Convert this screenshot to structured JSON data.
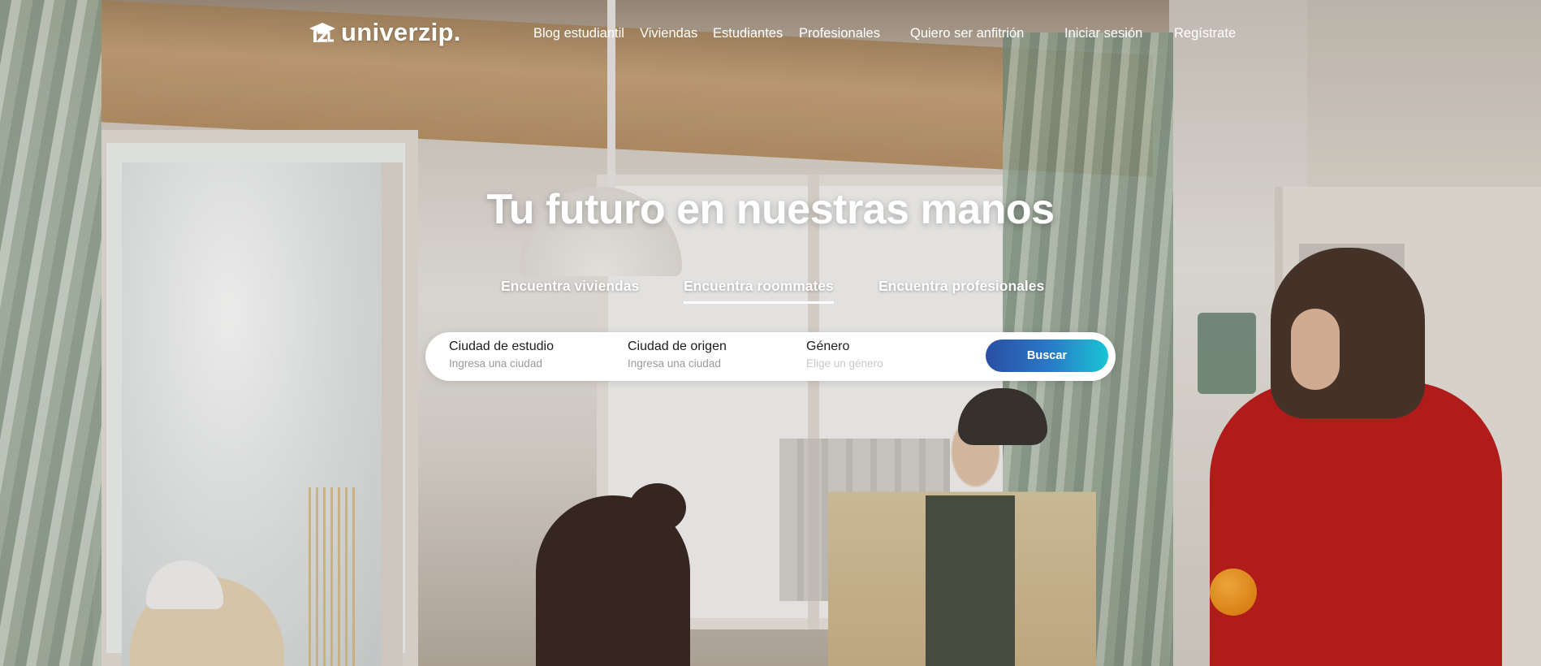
{
  "brand": {
    "name": "univerzip."
  },
  "nav": {
    "blog": "Blog estudiantil",
    "viviendas": "Viviendas",
    "estudiantes": "Estudiantes",
    "profesionales": "Profesionales",
    "anfitrion": "Quiero ser anfitrión",
    "login": "Iniciar sesión",
    "register": "Regístrate"
  },
  "hero": {
    "title": "Tu futuro en nuestras manos",
    "tabs": [
      {
        "label": "Encuentra viviendas",
        "active": false
      },
      {
        "label": "Encuentra roommates",
        "active": true
      },
      {
        "label": "Encuentra profesionales",
        "active": false
      }
    ]
  },
  "search": {
    "fields": [
      {
        "label": "Ciudad de estudio",
        "placeholder": "Ingresa una ciudad"
      },
      {
        "label": "Ciudad de origen",
        "placeholder": "Ingresa una ciudad"
      },
      {
        "label": "Género",
        "placeholder": "Elige un género"
      }
    ],
    "button": "Buscar"
  },
  "colors": {
    "button_gradient_start": "#2a4fa3",
    "button_gradient_end": "#19c4d4",
    "text_on_hero": "#ffffff"
  }
}
